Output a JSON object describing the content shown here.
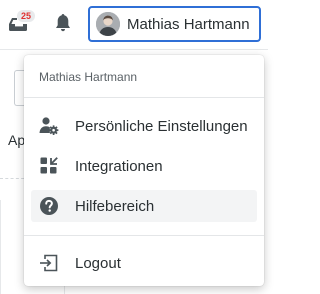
{
  "topbar": {
    "inbox_badge": "25",
    "user_name": "Mathias Hartmann"
  },
  "background": {
    "partial_text": "Ap"
  },
  "menu": {
    "header": "Mathias Hartmann",
    "items": [
      {
        "label": "Persönliche Einstellungen",
        "icon": "user-settings-icon"
      },
      {
        "label": "Integrationen",
        "icon": "integrations-icon"
      },
      {
        "label": "Hilfebereich",
        "icon": "help-icon"
      },
      {
        "label": "Logout",
        "icon": "logout-icon"
      }
    ]
  },
  "colors": {
    "accent": "#2f6fd6",
    "badge_text": "#e03131",
    "icon": "#4b5459"
  }
}
